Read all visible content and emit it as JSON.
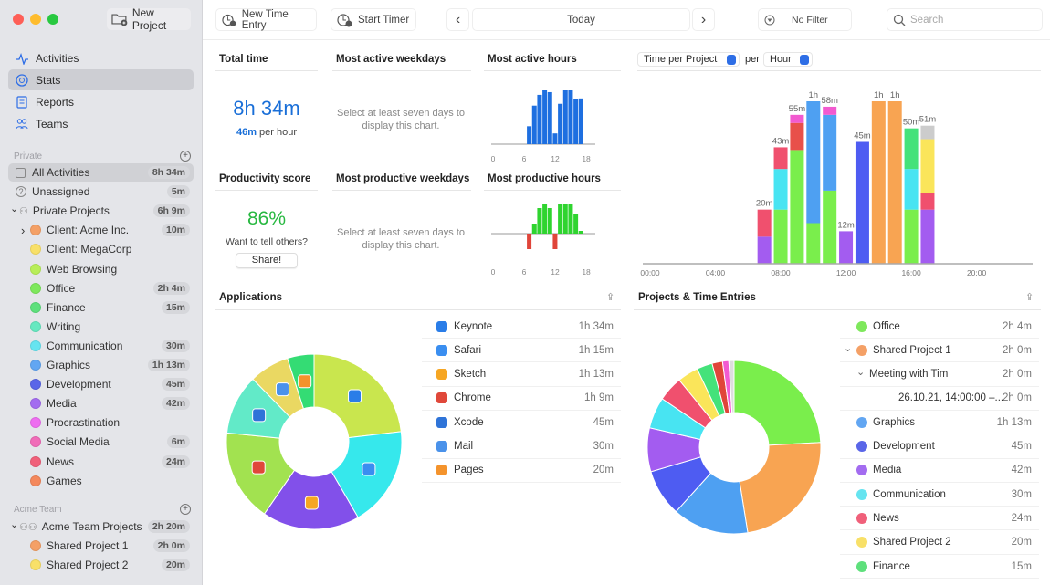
{
  "sidebar": {
    "new_project": "New Project",
    "nav": [
      {
        "label": "Activities",
        "icon": "activity-icon"
      },
      {
        "label": "Stats",
        "icon": "stats-icon",
        "selected": true
      },
      {
        "label": "Reports",
        "icon": "reports-icon"
      },
      {
        "label": "Teams",
        "icon": "teams-icon"
      }
    ],
    "private_label": "Private",
    "private_rows": [
      {
        "label": "All Activities",
        "badge": "8h 34m",
        "type": "all",
        "selected": true
      },
      {
        "label": "Unassigned",
        "badge": "5m",
        "type": "unassigned"
      },
      {
        "label": "Private Projects",
        "badge": "6h 9m",
        "type": "group"
      },
      {
        "label": "Client: Acme Inc.",
        "badge": "10m",
        "color": "#f4a066",
        "indent": true,
        "chevron": true
      },
      {
        "label": "Client: MegaCorp",
        "color": "#f8e068",
        "indent": true
      },
      {
        "label": "Web Browsing",
        "color": "#b8ee58",
        "indent": true
      },
      {
        "label": "Office",
        "badge": "2h 4m",
        "color": "#7ee85c",
        "indent": true
      },
      {
        "label": "Finance",
        "badge": "15m",
        "color": "#5ee07c",
        "indent": true
      },
      {
        "label": "Writing",
        "color": "#66e8c0",
        "indent": true
      },
      {
        "label": "Communication",
        "badge": "30m",
        "color": "#66e4f0",
        "indent": true
      },
      {
        "label": "Graphics",
        "badge": "1h 13m",
        "color": "#62a6f2",
        "indent": true
      },
      {
        "label": "Development",
        "badge": "45m",
        "color": "#5a66e8",
        "indent": true
      },
      {
        "label": "Media",
        "badge": "42m",
        "color": "#a36cf0",
        "indent": true
      },
      {
        "label": "Procrastination",
        "color": "#ee6ef0",
        "indent": true
      },
      {
        "label": "Social Media",
        "badge": "6m",
        "color": "#f06cb8",
        "indent": true
      },
      {
        "label": "News",
        "badge": "24m",
        "color": "#f0607a",
        "indent": true
      },
      {
        "label": "Games",
        "color": "#f4885c",
        "indent": true
      }
    ],
    "team_label": "Acme Team",
    "team_rows": [
      {
        "label": "Acme Team Projects",
        "badge": "2h 20m",
        "type": "teamgroup"
      },
      {
        "label": "Shared Project 1",
        "badge": "2h 0m",
        "color": "#f4a066",
        "indent": true
      },
      {
        "label": "Shared Project 2",
        "badge": "20m",
        "color": "#f8e068",
        "indent": true
      }
    ]
  },
  "toolbar": {
    "new_time_entry": "New Time Entry",
    "start_timer": "Start Timer",
    "date": "Today",
    "filter": "No Filter",
    "search_placeholder": "Search"
  },
  "stats": {
    "total_time": {
      "title": "Total time",
      "value": "8h 34m",
      "rate": "46m",
      "rate_suffix": "per hour"
    },
    "productivity": {
      "title": "Productivity score",
      "value": "86%",
      "prompt": "Want to tell others?",
      "share": "Share!"
    },
    "active_weekdays": {
      "title": "Most active weekdays",
      "empty": "Select at least seven days to display this chart."
    },
    "productive_weekdays": {
      "title": "Most productive weekdays",
      "empty": "Select at least seven days to display this chart."
    },
    "active_hours": {
      "title": "Most active hours"
    },
    "productive_hours": {
      "title": "Most productive hours"
    },
    "hourly": {
      "metric": "Time per Project",
      "per": "per",
      "unit": "Hour"
    },
    "applications": {
      "title": "Applications",
      "items": [
        {
          "label": "Keynote",
          "value": "1h 34m",
          "minutes": 94,
          "icon_color": "#2a7de8",
          "slice_color": "#c9e64e",
          "icon": "keynote-icon"
        },
        {
          "label": "Safari",
          "value": "1h 15m",
          "minutes": 75,
          "icon_color": "#3a8ef0",
          "slice_color": "#36e8ec",
          "icon": "safari-icon"
        },
        {
          "label": "Sketch",
          "value": "1h 13m",
          "minutes": 73,
          "icon_color": "#f6a623",
          "slice_color": "#8250ea",
          "icon": "sketch-icon"
        },
        {
          "label": "Chrome",
          "value": "1h 9m",
          "minutes": 69,
          "icon_color": "#e0483a",
          "slice_color": "#a2e250",
          "icon": "chrome-icon"
        },
        {
          "label": "Xcode",
          "value": "45m",
          "minutes": 45,
          "icon_color": "#2f74d8",
          "slice_color": "#62eac8",
          "icon": "xcode-icon"
        },
        {
          "label": "Mail",
          "value": "30m",
          "minutes": 30,
          "icon_color": "#4a92ea",
          "slice_color": "#ead862",
          "icon": "mail-icon"
        },
        {
          "label": "Pages",
          "value": "20m",
          "minutes": 20,
          "icon_color": "#f4932c",
          "slice_color": "#34dc74",
          "icon": "pages-icon"
        }
      ]
    },
    "projects": {
      "title": "Projects & Time Entries",
      "items": [
        {
          "label": "Office",
          "value": "2h 4m",
          "color": "#7ee85c"
        },
        {
          "label": "Shared Project 1",
          "value": "2h 0m",
          "color": "#f4a066",
          "chevron": true
        },
        {
          "label": "Meeting with Tim",
          "value": "2h 0m",
          "level": 1
        },
        {
          "label": "26.10.21, 14:00:00 –...",
          "value": "2h 0m",
          "level": 2
        },
        {
          "label": "Graphics",
          "value": "1h 13m",
          "color": "#62a6f2"
        },
        {
          "label": "Development",
          "value": "45m",
          "color": "#5a66e8"
        },
        {
          "label": "Media",
          "value": "42m",
          "color": "#a36cf0"
        },
        {
          "label": "Communication",
          "value": "30m",
          "color": "#66e4f0"
        },
        {
          "label": "News",
          "value": "24m",
          "color": "#f0607a"
        },
        {
          "label": "Shared Project 2",
          "value": "20m",
          "color": "#f8e068"
        },
        {
          "label": "Finance",
          "value": "15m",
          "color": "#5ee07c"
        }
      ]
    }
  },
  "chart_data": [
    {
      "type": "bar",
      "name": "most-active-hours",
      "x": [
        7,
        8,
        9,
        10,
        11,
        12,
        13,
        14,
        15,
        16,
        17
      ],
      "values": [
        20,
        43,
        55,
        60,
        58,
        12,
        45,
        60,
        60,
        50,
        51
      ],
      "xticks": [
        "0",
        "6",
        "12",
        "18"
      ],
      "xlim": [
        0,
        23
      ],
      "color": "#1e6fe0"
    },
    {
      "type": "bar",
      "name": "most-productive-hours",
      "x": [
        7,
        8,
        9,
        10,
        11,
        12,
        13,
        14,
        15,
        16,
        17
      ],
      "values": [
        -17,
        11,
        28,
        32,
        28,
        -17,
        32,
        32,
        32,
        22,
        3
      ],
      "xticks": [
        "0",
        "6",
        "12",
        "18"
      ],
      "xlim": [
        0,
        23
      ],
      "positive_color": "#2fd42f",
      "negative_color": "#e0453a"
    },
    {
      "type": "bar",
      "stacked": true,
      "name": "time-per-project-per-hour",
      "xticks": [
        "00:00",
        "04:00",
        "08:00",
        "12:00",
        "16:00",
        "20:00"
      ],
      "xlim": [
        0,
        24
      ],
      "ylim": [
        0,
        60
      ],
      "bars": [
        {
          "hour": 7,
          "label": "20m",
          "stack": [
            [
              10,
              "#a35cf0"
            ],
            [
              10,
              "#f0506e"
            ]
          ]
        },
        {
          "hour": 8,
          "label": "43m",
          "stack": [
            [
              20,
              "#7aee4c"
            ],
            [
              15,
              "#48e4f2"
            ],
            [
              8,
              "#f0506e"
            ]
          ]
        },
        {
          "hour": 9,
          "label": "55m",
          "stack": [
            [
              42,
              "#7aee4c"
            ],
            [
              10,
              "#e8504a"
            ],
            [
              3,
              "#f25ad0"
            ]
          ]
        },
        {
          "hour": 10,
          "label": "1h",
          "stack": [
            [
              15,
              "#7aee4c"
            ],
            [
              45,
              "#4ea0f2"
            ]
          ]
        },
        {
          "hour": 11,
          "label": "58m",
          "stack": [
            [
              27,
              "#7aee4c"
            ],
            [
              28,
              "#4ea0f2"
            ],
            [
              3,
              "#f25ad0"
            ]
          ]
        },
        {
          "hour": 12,
          "label": "12m",
          "stack": [
            [
              12,
              "#a35cf0"
            ]
          ]
        },
        {
          "hour": 13,
          "label": "45m",
          "stack": [
            [
              45,
              "#4e5cf2"
            ]
          ]
        },
        {
          "hour": 14,
          "label": "1h",
          "stack": [
            [
              60,
              "#f8a452"
            ]
          ]
        },
        {
          "hour": 15,
          "label": "1h",
          "stack": [
            [
              60,
              "#f8a452"
            ]
          ]
        },
        {
          "hour": 16,
          "label": "50m",
          "stack": [
            [
              20,
              "#7aee4c"
            ],
            [
              15,
              "#48e4f2"
            ],
            [
              15,
              "#44e27a"
            ]
          ]
        },
        {
          "hour": 17,
          "label": "51m",
          "stack": [
            [
              20,
              "#a35cf0"
            ],
            [
              6,
              "#f0506e"
            ],
            [
              20,
              "#fae55a"
            ],
            [
              5,
              "#cccccc"
            ]
          ]
        }
      ]
    },
    {
      "type": "pie",
      "name": "applications-donut",
      "values_from": "stats.applications.items"
    },
    {
      "type": "pie",
      "name": "projects-donut",
      "slices": [
        {
          "label": "Office",
          "minutes": 124,
          "color": "#7aee4c"
        },
        {
          "label": "Shared Project 1",
          "minutes": 120,
          "color": "#f8a452"
        },
        {
          "label": "Graphics",
          "minutes": 73,
          "color": "#4ea0f2"
        },
        {
          "label": "Development",
          "minutes": 45,
          "color": "#4e5cf2"
        },
        {
          "label": "Media",
          "minutes": 42,
          "color": "#a35cf0"
        },
        {
          "label": "Communication",
          "minutes": 30,
          "color": "#48e4f2"
        },
        {
          "label": "News",
          "minutes": 24,
          "color": "#f0506e"
        },
        {
          "label": "Shared Project 2",
          "minutes": 20,
          "color": "#fae55a"
        },
        {
          "label": "Finance",
          "minutes": 15,
          "color": "#44e27a"
        },
        {
          "label": "Client: Acme Inc.",
          "minutes": 10,
          "color": "#e0453a"
        },
        {
          "label": "Social Media",
          "minutes": 6,
          "color": "#f25ad0"
        },
        {
          "label": "Unassigned",
          "minutes": 5,
          "color": "#dddddd"
        }
      ]
    }
  ]
}
